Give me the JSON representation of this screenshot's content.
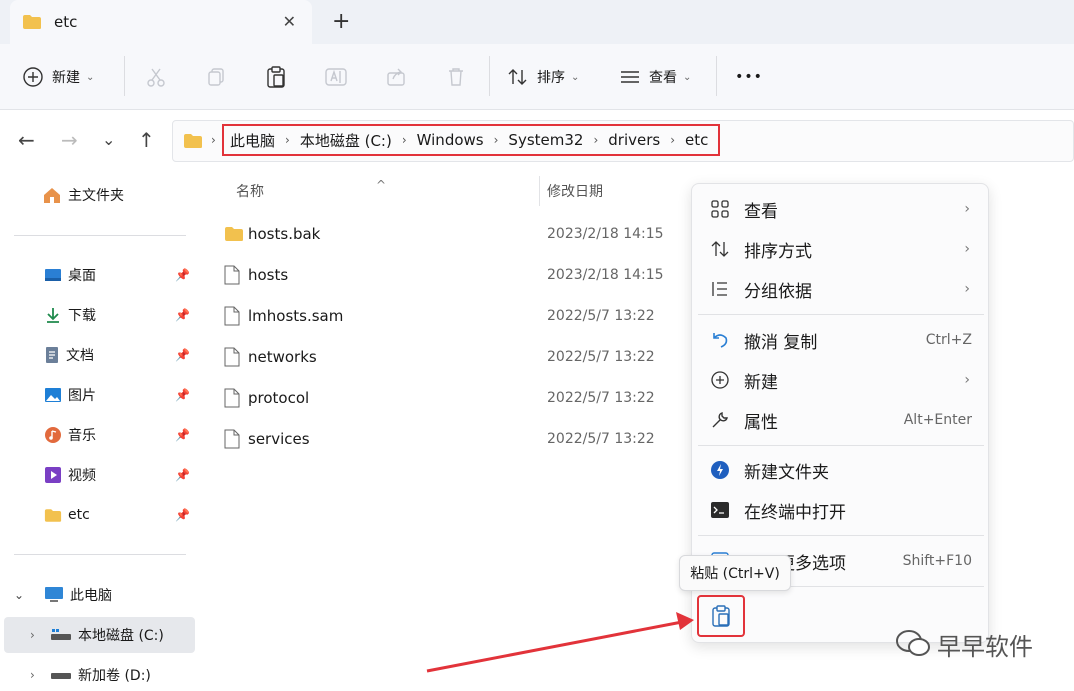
{
  "window": {
    "tab_title": "etc",
    "close_glyph": "✕",
    "new_tab_glyph": "+"
  },
  "toolbar": {
    "new_label": "新建",
    "sort_label": "排序",
    "view_label": "查看",
    "more_glyph": "•••",
    "caret": "⌄"
  },
  "nav": {
    "back": "←",
    "forward": "→",
    "recent": "⌄",
    "up": "↑"
  },
  "breadcrumb": [
    "此电脑",
    "本地磁盘 (C:)",
    "Windows",
    "System32",
    "drivers",
    "etc"
  ],
  "breadcrumb_sep": "›",
  "sidebar": {
    "home": "主文件夹",
    "quick": [
      {
        "label": "桌面",
        "icon": "desktop-icon",
        "color": "#2a7fd4"
      },
      {
        "label": "下载",
        "icon": "download-icon",
        "color": "#1f8a4c"
      },
      {
        "label": "文档",
        "icon": "document-icon",
        "color": "#6b7f99"
      },
      {
        "label": "图片",
        "icon": "pictures-icon",
        "color": "#1e7fd6"
      },
      {
        "label": "音乐",
        "icon": "music-icon",
        "color": "#e26a3d"
      },
      {
        "label": "视频",
        "icon": "video-icon",
        "color": "#7a3fc4"
      },
      {
        "label": "etc",
        "icon": "folder-icon",
        "color": "#f2c14e"
      }
    ],
    "this_pc": "此电脑",
    "drive_c": "本地磁盘 (C:)",
    "drive_d": "新加卷 (D:)"
  },
  "columns": {
    "name": "名称",
    "modified": "修改日期",
    "sort_glyph": "^"
  },
  "files": [
    {
      "name": "hosts.bak",
      "date": "2023/2/18 14:15",
      "type": "folder"
    },
    {
      "name": "hosts",
      "date": "2023/2/18 14:15",
      "type": "file"
    },
    {
      "name": "lmhosts.sam",
      "date": "2022/5/7 13:22",
      "type": "file"
    },
    {
      "name": "networks",
      "date": "2022/5/7 13:22",
      "type": "file"
    },
    {
      "name": "protocol",
      "date": "2022/5/7 13:22",
      "type": "file"
    },
    {
      "name": "services",
      "date": "2022/5/7 13:22",
      "type": "file"
    }
  ],
  "context_menu": {
    "view": "查看",
    "sort_by": "排序方式",
    "group_by": "分组依据",
    "undo": "撤消 复制",
    "undo_shortcut": "Ctrl+Z",
    "new": "新建",
    "properties": "属性",
    "properties_shortcut": "Alt+Enter",
    "new_folder": "新建文件夹",
    "open_terminal": "在终端中打开",
    "more_options": "显示更多选项",
    "more_shortcut": "Shift+F10",
    "submenu_arrow": "›"
  },
  "tooltip": "粘贴 (Ctrl+V)",
  "watermark": "早早软件",
  "colors": {
    "highlight": "#e2333a",
    "accent": "#0067c0",
    "folder": "#f2c14e"
  }
}
